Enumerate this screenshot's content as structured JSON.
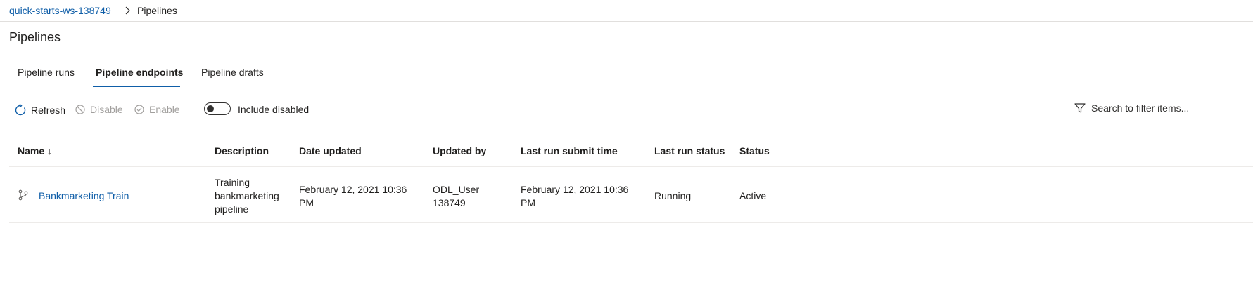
{
  "breadcrumb": {
    "workspace": "quick-starts-ws-138749",
    "current": "Pipelines"
  },
  "page": {
    "title": "Pipelines"
  },
  "tabs": [
    {
      "label": "Pipeline runs",
      "active": false
    },
    {
      "label": "Pipeline endpoints",
      "active": true
    },
    {
      "label": "Pipeline drafts",
      "active": false
    }
  ],
  "toolbar": {
    "refresh": "Refresh",
    "disable": "Disable",
    "enable": "Enable",
    "include_disabled": "Include disabled",
    "include_disabled_on": false,
    "search_placeholder": "Search to filter items..."
  },
  "table": {
    "columns": {
      "name": "Name ↓",
      "description": "Description",
      "date_updated": "Date updated",
      "updated_by": "Updated by",
      "last_run_submit_time": "Last run submit time",
      "last_run_status": "Last run status",
      "status": "Status"
    },
    "rows": [
      {
        "name": "Bankmarketing Train",
        "description": [
          "Training",
          "bankmarketing",
          "pipeline"
        ],
        "date_updated": [
          "February 12, 2021 10:36",
          "PM"
        ],
        "updated_by": [
          "ODL_User",
          "138749"
        ],
        "last_run_submit_time": [
          "February 12, 2021 10:36",
          "PM"
        ],
        "last_run_status": "Running",
        "status": "Active"
      }
    ]
  },
  "colors": {
    "link": "#0f5ea8",
    "text": "#201f1e",
    "disabled": "#a19f9d",
    "border": "#edebe9"
  },
  "icons": [
    "chevron-right-icon",
    "refresh-icon",
    "disable-icon",
    "enable-icon",
    "filter-icon",
    "pipeline-icon"
  ]
}
